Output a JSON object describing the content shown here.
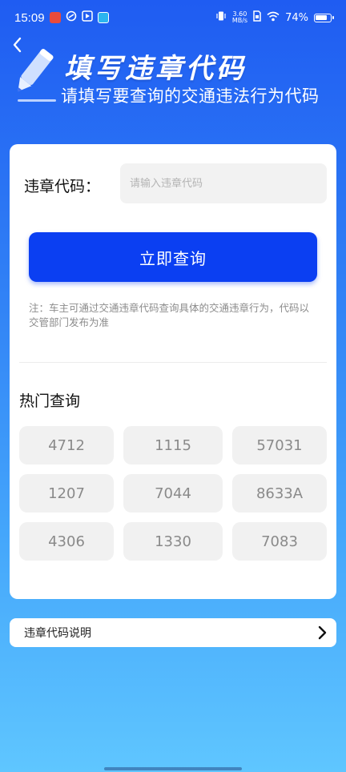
{
  "status_bar": {
    "time": "15:09",
    "net_speed_value": "3.60",
    "net_speed_unit": "MB/s",
    "battery": "74%"
  },
  "header": {
    "title": "填写违章代码",
    "subtitle": "请填写要查询的交通违法行为代码"
  },
  "form": {
    "label": "违章代码：",
    "input_value": "",
    "input_placeholder": "请输入违章代码",
    "submit_label": "立即查询",
    "note": "注：车主可通过交通违章代码查询具体的交通违章行为，代码以交管部门发布为准"
  },
  "hot": {
    "title": "热门查询",
    "codes": [
      "4712",
      "1115",
      "57031",
      "1207",
      "7044",
      "8633A",
      "4306",
      "1330",
      "7083"
    ]
  },
  "explain": {
    "label": "违章代码说明"
  },
  "colors": {
    "primary_button": "#0b3ff2",
    "background_top": "#1f5cf2",
    "background_bottom": "#5fc6ff"
  }
}
